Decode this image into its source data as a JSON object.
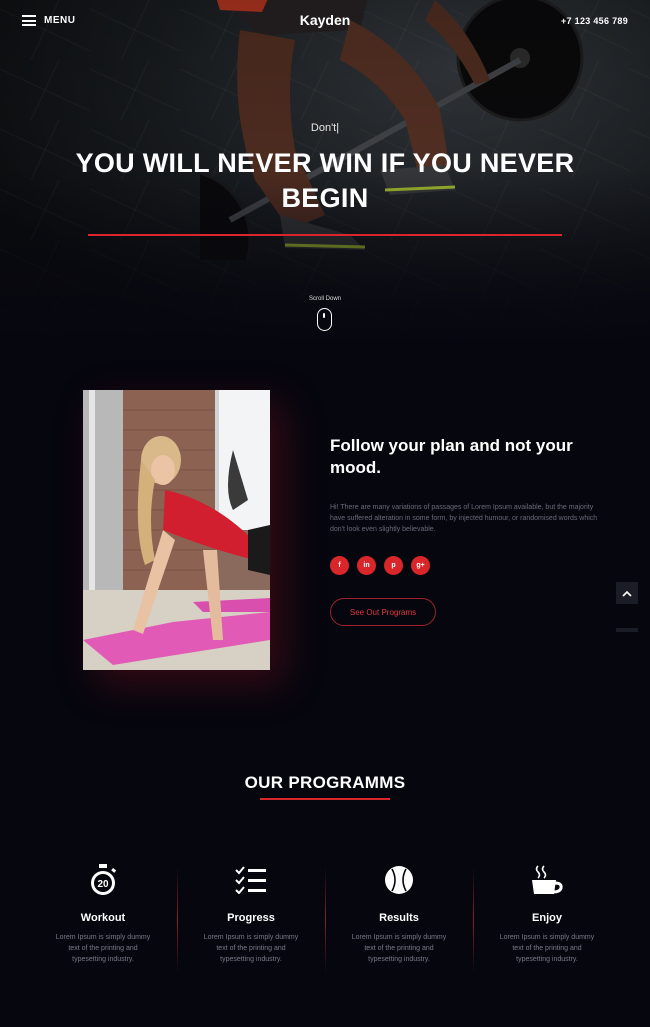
{
  "nav": {
    "menu_label": "MENU",
    "brand": "Kayden",
    "phone": "+7 123 456 789"
  },
  "hero": {
    "typed_text": "Don't|",
    "headline_line1": "YOU WILL NEVER WIN IF YOU NEVER",
    "headline_line2": "BEGIN",
    "scroll_label": "Scroll Down"
  },
  "about": {
    "title_line1": "Follow your plan and not your",
    "title_line2": "mood.",
    "text": "Hi! There are many variations of passages of Lorem Ipsum available, but the majority have suffered alteration in some form, by injected humour, or randomised words which don't look even slightly believable.",
    "socials": [
      {
        "label": "f",
        "icon": "facebook-icon"
      },
      {
        "label": "in",
        "icon": "linkedin-icon"
      },
      {
        "label": "p",
        "icon": "pinterest-icon"
      },
      {
        "label": "g+",
        "icon": "google-plus-icon"
      }
    ],
    "cta_label": "See Out Programs"
  },
  "programs": {
    "title": "OUR PROGRAMMS",
    "items": [
      {
        "name": "Workout",
        "icon": "stopwatch-20-icon",
        "desc": "Lorem Ipsum is simply dummy text of the printing and typesetting industry."
      },
      {
        "name": "Progress",
        "icon": "checklist-icon",
        "desc": "Lorem Ipsum is simply dummy text of the printing and typesetting industry."
      },
      {
        "name": "Results",
        "icon": "baseball-icon",
        "desc": "Lorem Ipsum is simply dummy text of the printing and typesetting industry."
      },
      {
        "name": "Enjoy",
        "icon": "coffee-cup-icon",
        "desc": "Lorem Ipsum is simply dummy text of the printing and typesetting industry."
      }
    ]
  },
  "colors": {
    "accent": "#d9262b",
    "background": "#06060f"
  }
}
